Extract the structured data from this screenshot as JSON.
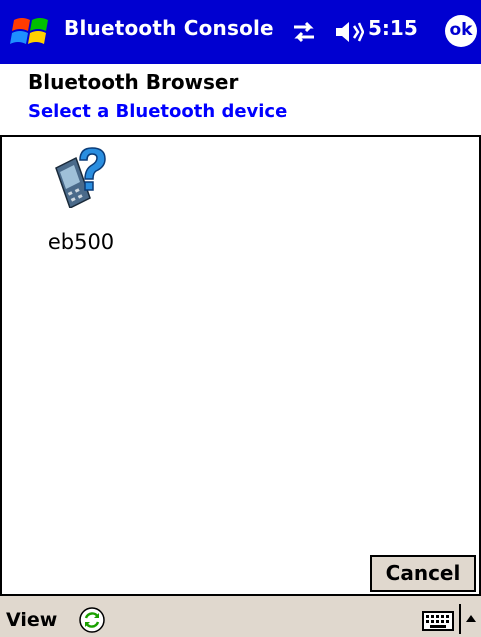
{
  "titlebar": {
    "app_title": "Bluetooth Console",
    "clock": "5:15",
    "ok_label": "ok",
    "icons": [
      "windows-start-icon",
      "connectivity-icon",
      "volume-icon"
    ]
  },
  "header": {
    "title": "Bluetooth Browser",
    "subtitle": "Select a Bluetooth device"
  },
  "devices": [
    {
      "label": "eb500",
      "icon": "unknown-device-icon"
    }
  ],
  "actions": {
    "cancel_label": "Cancel"
  },
  "menubar": {
    "view_label": "View",
    "icons": [
      "refresh-icon",
      "keyboard-icon",
      "sip-arrow-icon"
    ]
  },
  "colors": {
    "titlebar_bg": "#0000d0",
    "subtitle": "#0000ff",
    "menubar_bg": "#e0d8ce"
  }
}
